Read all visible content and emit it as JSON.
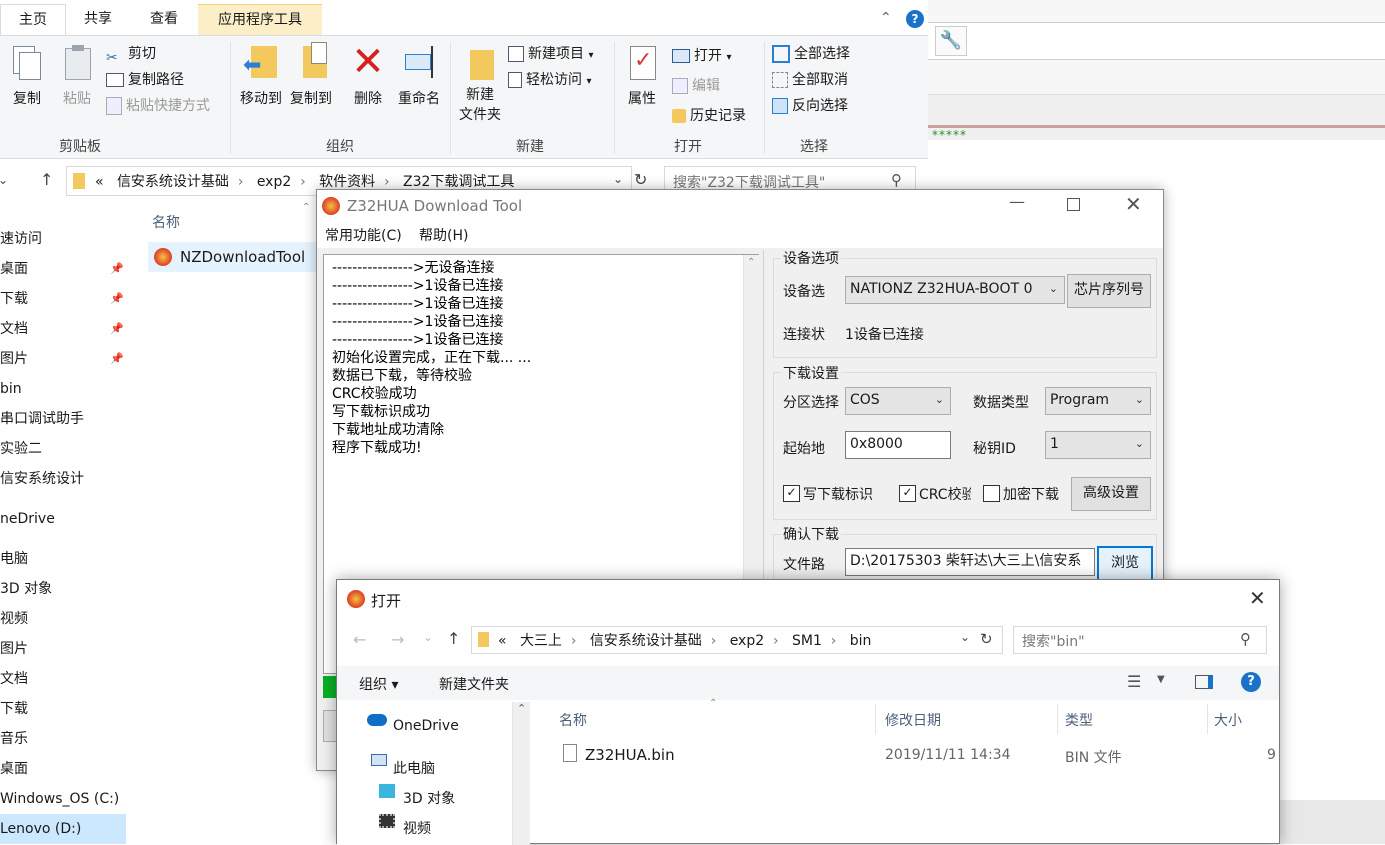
{
  "background": {
    "stars": "*****"
  },
  "explorer": {
    "tabs": {
      "home": "主页",
      "share": "共享",
      "view": "查看",
      "app_tools": "应用程序工具"
    },
    "ribbon": {
      "clipboard": {
        "copy": "复制",
        "paste": "粘贴",
        "cut": "剪切",
        "copy_path": "复制路径",
        "paste_shortcut": "粘贴快捷方式",
        "label": "剪贴板"
      },
      "organize": {
        "move_to": "移动到",
        "copy_to": "复制到",
        "delete": "删除",
        "rename": "重命名",
        "label": "组织"
      },
      "new": {
        "new_folder_line1": "新建",
        "new_folder_line2": "文件夹",
        "new_item": "新建项目",
        "easy_access": "轻松访问",
        "label": "新建"
      },
      "open": {
        "properties": "属性",
        "open": "打开",
        "edit": "编辑",
        "history": "历史记录",
        "label": "打开"
      },
      "select": {
        "select_all": "全部选择",
        "select_none": "全部取消",
        "invert": "反向选择",
        "label": "选择"
      }
    },
    "address": {
      "prefix": "«",
      "crumbs": [
        "信安系统设计基础",
        "exp2",
        "软件资料",
        "Z32下载调试工具"
      ],
      "search_placeholder": "搜索\"Z32下载调试工具\""
    },
    "nav_items": [
      "速访问",
      "桌面",
      "下载",
      "文档",
      "图片",
      "bin",
      "串口调试助手",
      "实验二",
      "信安系统设计",
      "neDrive",
      "电脑",
      "3D 对象",
      "视频",
      "图片",
      "文档",
      "下载",
      "音乐",
      "桌面",
      "Windows_OS (C:)",
      "Lenovo (D:)"
    ],
    "column_name": "名称",
    "file": "NZDownloadTool"
  },
  "tool": {
    "title": "Z32HUA Download Tool",
    "menu": {
      "functions": "常用功能(C)",
      "help": "帮助(H)"
    },
    "log": [
      "---------------->无设备连接",
      "---------------->1设备已连接",
      "---------------->1设备已连接",
      "---------------->1设备已连接",
      "---------------->1设备已连接",
      "初始化设置完成，正在下载... ...",
      "数据已下载，等待校验",
      "CRC校验成功",
      "写下载标识成功",
      "下载地址成功清除",
      "程序下载成功!"
    ],
    "device": {
      "group": "设备选项",
      "device_label": "设备选",
      "device_value": "NATIONZ Z32HUA-BOOT 0",
      "serial_button": "芯片序列号",
      "status_label": "连接状",
      "status_value": "1设备已连接"
    },
    "download": {
      "group": "下载设置",
      "partition_label": "分区选择",
      "partition_value": "COS",
      "datatype_label": "数据类型",
      "datatype_value": "Program",
      "start_label": "起始地",
      "start_value": "0x8000",
      "key_label": "秘钥ID",
      "key_value": "1",
      "chk_write_flag": "写下载标识",
      "chk_crc": "CRC校验",
      "chk_encrypt": "加密下载",
      "advanced_button": "高级设置"
    },
    "confirm": {
      "group": "确认下载",
      "path_label": "文件路",
      "path_value": "D:\\20175303 柴轩达\\大三上\\信安系",
      "browse_button": "浏览"
    }
  },
  "dialog": {
    "title": "打开",
    "crumbs": [
      "大三上",
      "信安系统设计基础",
      "exp2",
      "SM1",
      "bin"
    ],
    "prefix": "«",
    "search_placeholder": "搜索\"bin\"",
    "toolbar": {
      "organize": "组织 ▾",
      "new_folder": "新建文件夹"
    },
    "nav": [
      "OneDrive",
      "此电脑",
      "3D 对象",
      "视频"
    ],
    "columns": {
      "name": "名称",
      "modified": "修改日期",
      "type": "类型",
      "size": "大小"
    },
    "files": [
      {
        "name": "Z32HUA.bin",
        "modified": "2019/11/11 14:34",
        "type": "BIN 文件",
        "size": "9"
      }
    ]
  }
}
